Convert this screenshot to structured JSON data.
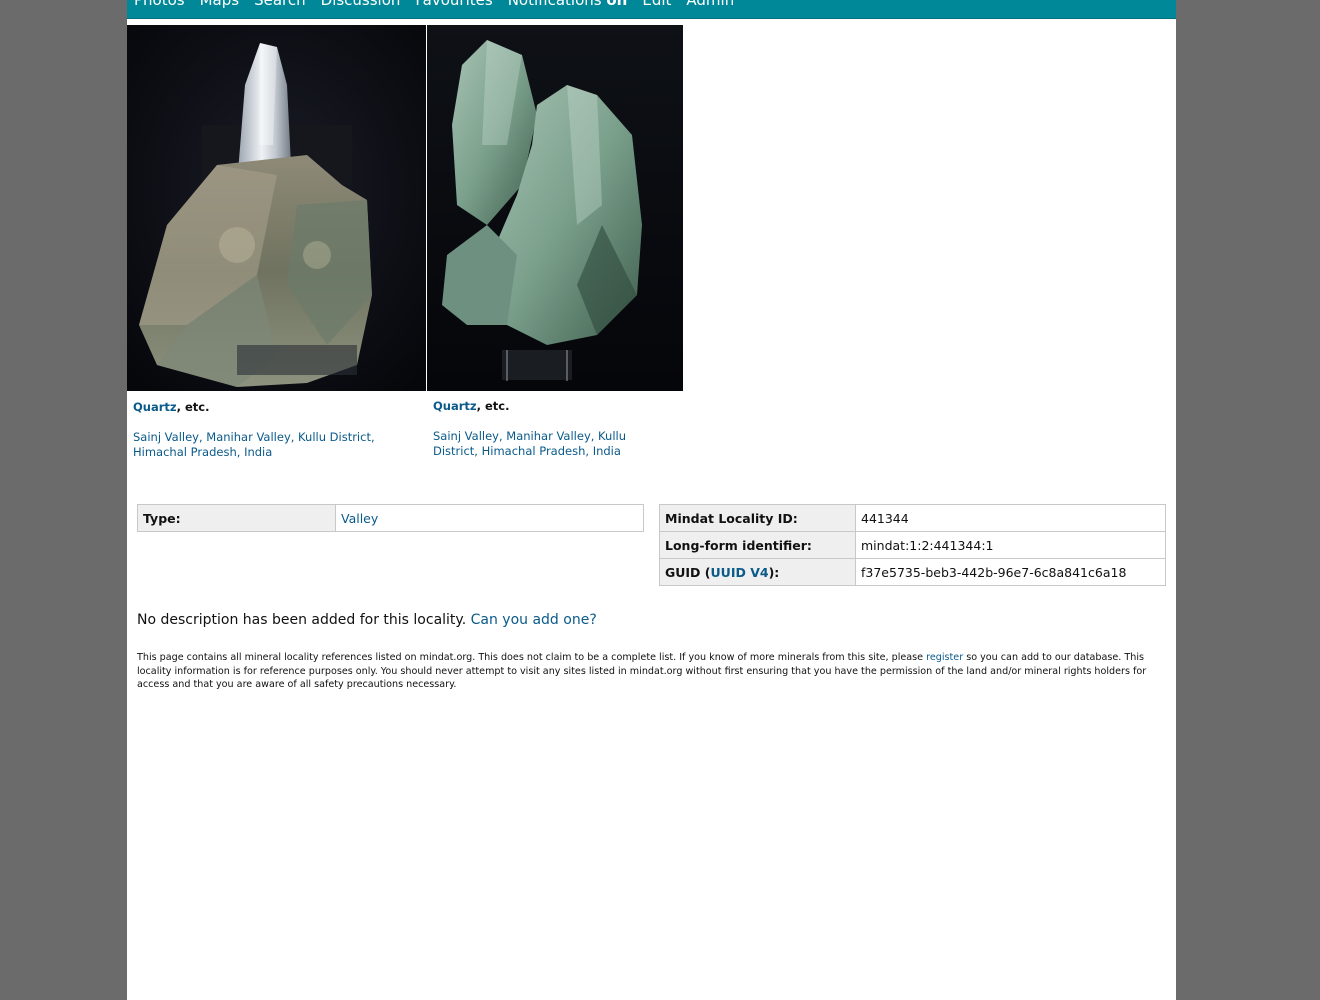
{
  "nav": {
    "items": [
      "Photos",
      "Maps",
      "Search",
      "Discussion",
      "Favourites",
      "Notifications",
      "Edit",
      "Admin"
    ],
    "notifications_state": "on"
  },
  "photos": [
    {
      "mineral": "Quartz",
      "etc": ", etc.",
      "locality": "Sainj Valley, Manihar Valley, Kullu District, Himachal Pradesh, India"
    },
    {
      "mineral": "Quartz",
      "etc": ", etc.",
      "locality": "Sainj Valley, Manihar Valley, Kullu District, Himachal Pradesh, India"
    }
  ],
  "type_table": {
    "label": "Type:",
    "value": "Valley"
  },
  "id_table": {
    "locality_id_label": "Mindat Locality ID:",
    "locality_id_value": "441344",
    "longform_label": "Long-form identifier:",
    "longform_value": "mindat:1:2:441344:1",
    "guid_label_prefix": "GUID (",
    "guid_link": "UUID V4",
    "guid_label_suffix": "):",
    "guid_value": "f37e5735-beb3-442b-96e7-6c8a841c6a18"
  },
  "description": {
    "text": "No description has been added for this locality.",
    "link": "Can you add one?"
  },
  "disclaimer": {
    "before": "This page contains all mineral locality references listed on mindat.org. This does not claim to be a complete list. If you know of more minerals from this site, please ",
    "link": "register",
    "after": " so you can add to our database. This locality information is for reference purposes only. You should never attempt to visit any sites listed in mindat.org without first ensuring that you have the permission of the land and/or mineral rights holders for access and that you are aware of all safety precautions necessary."
  },
  "colors": {
    "navbar": "#008899",
    "link": "#0a5a8a",
    "page_bg": "#6b6b6b"
  }
}
